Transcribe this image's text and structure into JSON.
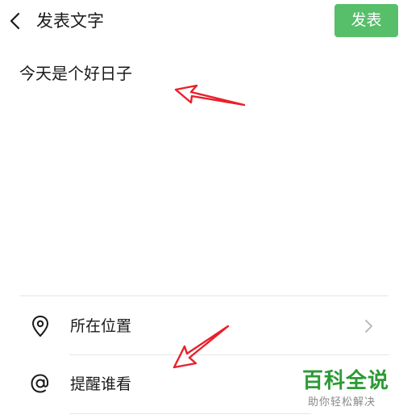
{
  "header": {
    "back_icon": "chevron-left-icon",
    "title": "发表文字",
    "publish_label": "发表",
    "publish_color": "#57be6a"
  },
  "composer": {
    "text": "今天是个好日子"
  },
  "options": [
    {
      "icon": "location-pin-icon",
      "label": "所在位置",
      "has_chevron": true
    },
    {
      "icon": "at-sign-icon",
      "label": "提醒谁看",
      "has_chevron": false
    }
  ],
  "annotations": {
    "arrow_color": "#e8202a"
  },
  "watermark": {
    "title": "百科全说",
    "subtitle": "助你轻松解决",
    "title_color": "#2c9a34"
  }
}
